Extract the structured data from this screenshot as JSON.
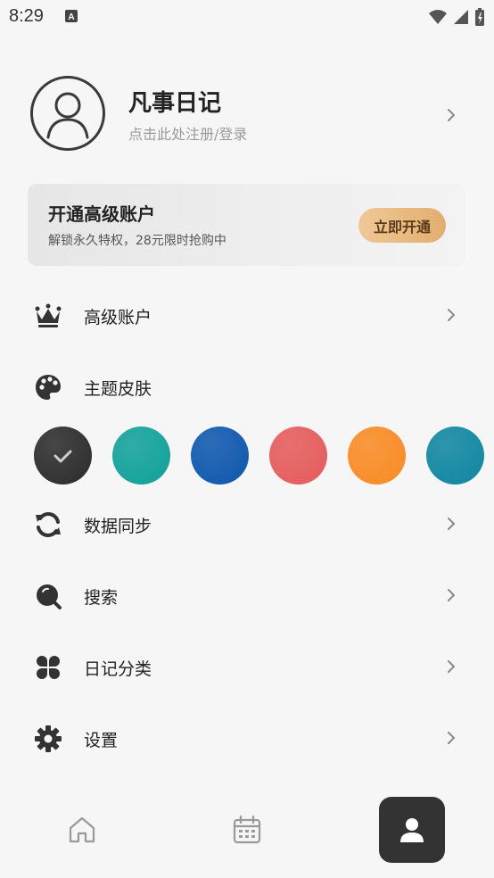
{
  "status_bar": {
    "time": "8:29"
  },
  "profile": {
    "app_name": "凡事日记",
    "login_hint": "点击此处注册/登录"
  },
  "premium_card": {
    "title": "开通高级账户",
    "subtitle": "解锁永久特权，28元限时抢购中",
    "button_label": "立即开通"
  },
  "menu": {
    "premium": "高级账户",
    "theme": "主题皮肤",
    "sync": "数据同步",
    "search": "搜索",
    "categories": "日记分类",
    "settings": "设置"
  },
  "theme_swatches": [
    {
      "color": "#2b2b2b",
      "selected": true
    },
    {
      "color": "#10a19a",
      "selected": false
    },
    {
      "color": "#0d57ad",
      "selected": false
    },
    {
      "color": "#e55b5b",
      "selected": false
    },
    {
      "color": "#f98a23",
      "selected": false
    },
    {
      "color": "#0f86a1",
      "selected": false
    }
  ],
  "bottom_nav": {
    "items": [
      "home-icon",
      "calendar-icon",
      "user-icon"
    ],
    "active": "user-icon"
  },
  "colors": {
    "accent": "#333333",
    "premium_button": "#e8bb80",
    "chevron": "#8a8a8a"
  }
}
